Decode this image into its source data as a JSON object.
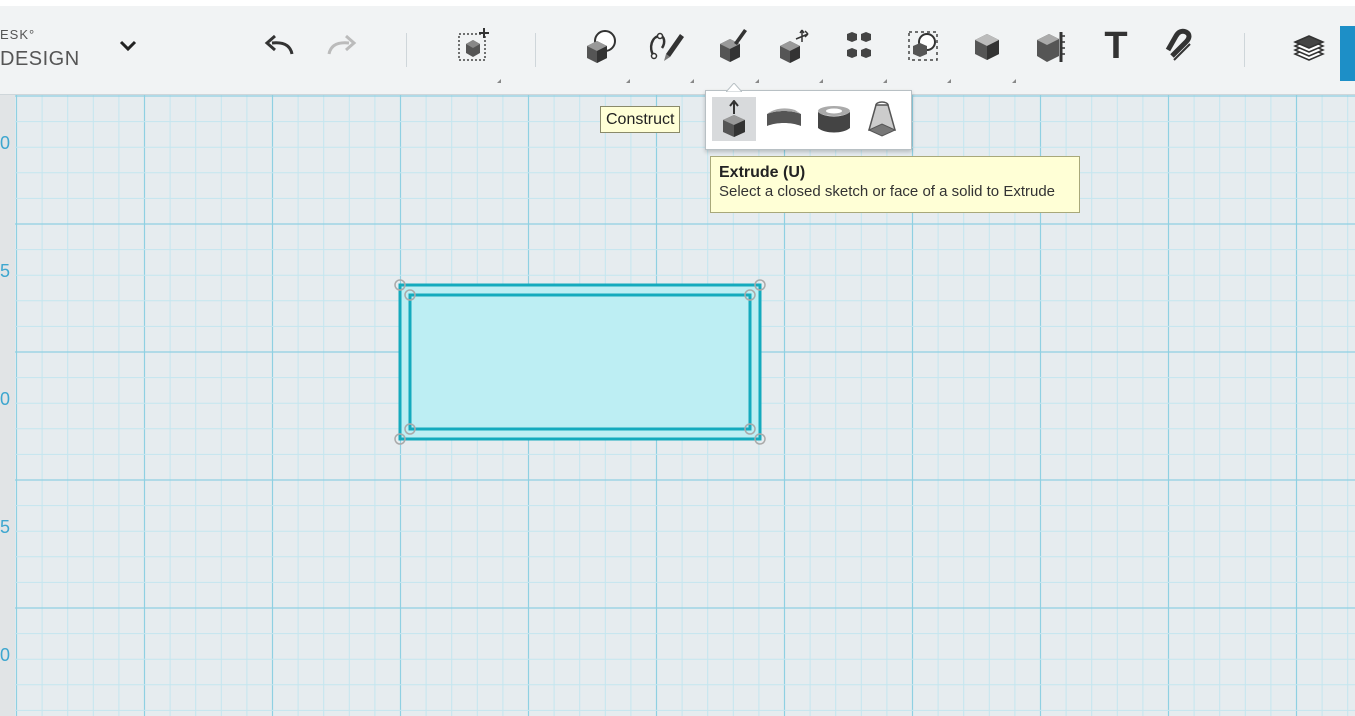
{
  "app": {
    "brand_line1": "ESK°",
    "brand_line2": "DESIGN"
  },
  "toolbar": {
    "tools": [
      {
        "name": "undo-button",
        "icon": "undo-icon"
      },
      {
        "name": "redo-button",
        "icon": "redo-icon"
      },
      {
        "name": "transform-button",
        "icon": "transform-icon"
      },
      {
        "name": "primitives-button",
        "icon": "primitives-icon"
      },
      {
        "name": "sketch-button",
        "icon": "sketch-icon"
      },
      {
        "name": "construct-button",
        "icon": "construct-icon"
      },
      {
        "name": "modify-button",
        "icon": "modify-icon"
      },
      {
        "name": "pattern-button",
        "icon": "pattern-icon"
      },
      {
        "name": "group-button",
        "icon": "group-icon"
      },
      {
        "name": "combine-button",
        "icon": "combine-icon"
      },
      {
        "name": "measure-button",
        "icon": "measure-icon"
      },
      {
        "name": "text-button",
        "icon": "text-icon"
      },
      {
        "name": "snap-button",
        "icon": "snap-icon"
      },
      {
        "name": "layers-button",
        "icon": "layers-icon"
      }
    ],
    "text_tool_glyph": "T"
  },
  "tooltips": {
    "construct": "Construct",
    "extrude_title": "Extrude (U)",
    "extrude_desc": "Select a closed sketch or face of a solid to Extrude"
  },
  "flyout": {
    "items": [
      {
        "name": "extrude",
        "icon": "extrude-icon",
        "active": true
      },
      {
        "name": "sweep",
        "icon": "sweep-icon",
        "active": false
      },
      {
        "name": "revolve",
        "icon": "revolve-icon",
        "active": false
      },
      {
        "name": "loft",
        "icon": "loft-icon",
        "active": false
      }
    ]
  },
  "ruler": {
    "labels": [
      "0",
      "5",
      "0",
      "5",
      "0"
    ]
  },
  "colors": {
    "grid_minor": "#c4e6ef",
    "grid_major": "#8fd0e2",
    "sketch_stroke": "#14aabd",
    "sketch_fill": "#bdeef3",
    "accent": "#1d8fc7"
  }
}
